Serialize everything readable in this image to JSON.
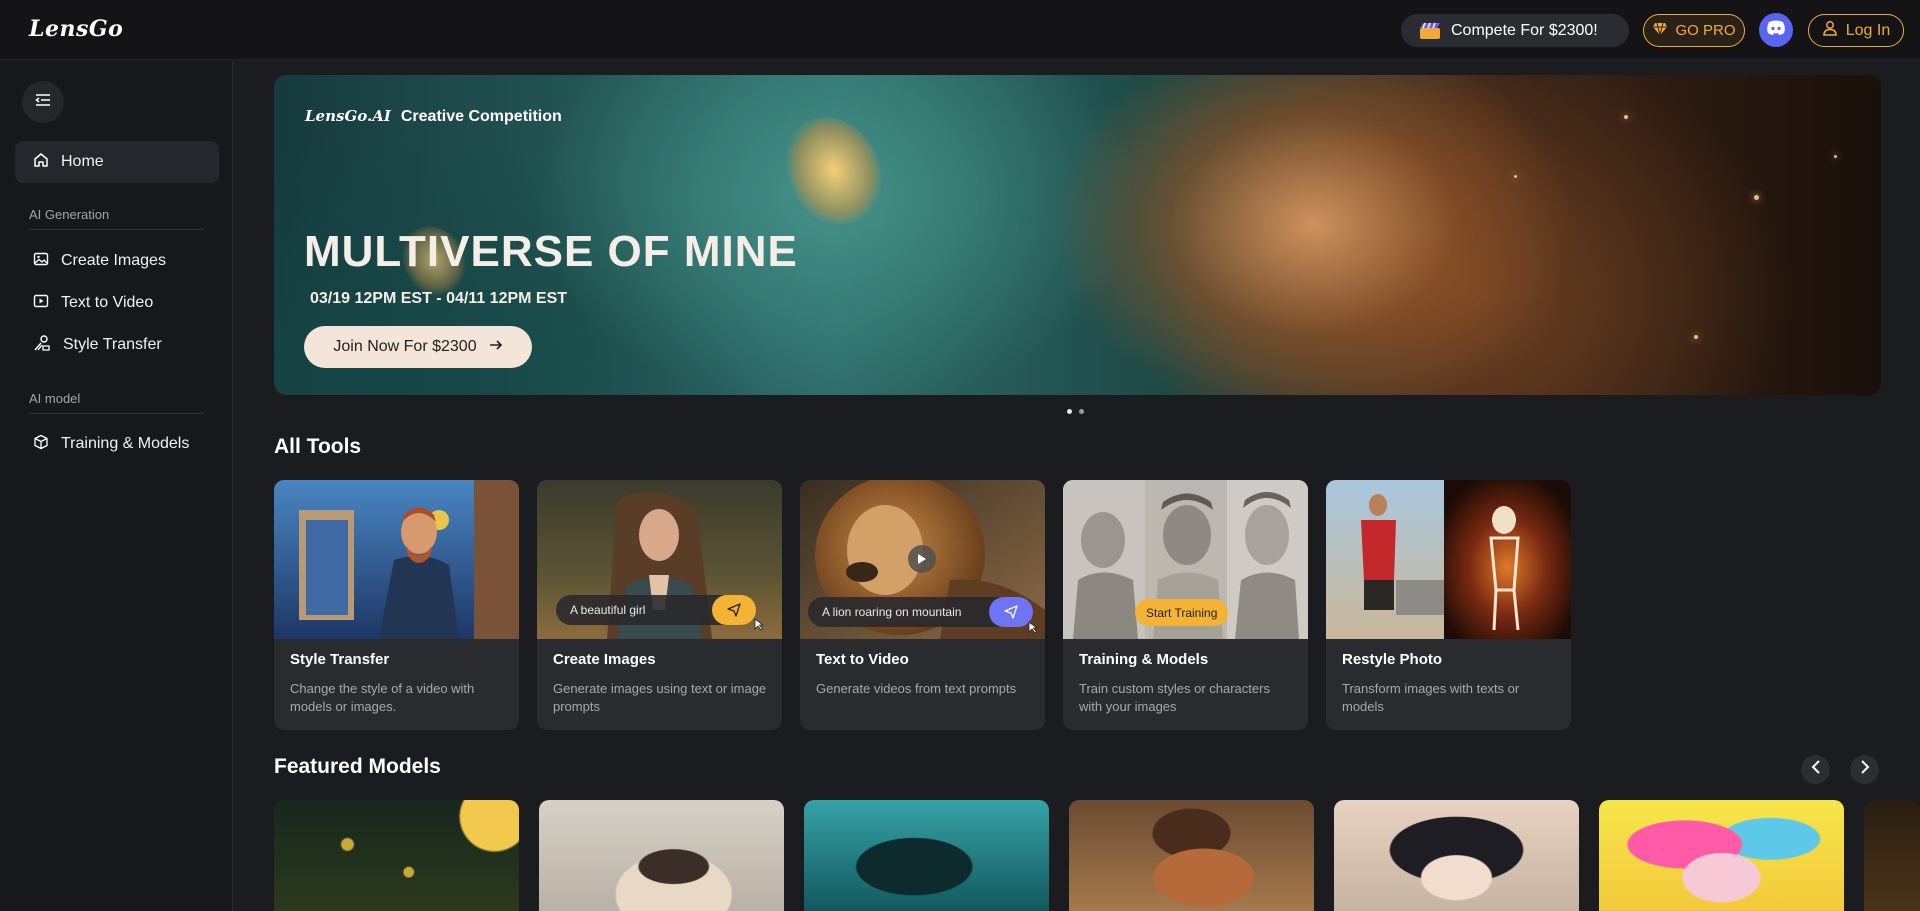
{
  "header": {
    "logo": "LensGo",
    "compete_label": "Compete For $2300!",
    "gopro_label": "GO PRO",
    "login_label": "Log In"
  },
  "sidebar": {
    "home_label": "Home",
    "section_ai_generation": "AI Generation",
    "items": [
      {
        "label": "Create Images",
        "icon": "image-icon"
      },
      {
        "label": "Text to Video",
        "icon": "video-play-icon"
      },
      {
        "label": "Style Transfer",
        "icon": "style-transfer-icon"
      }
    ],
    "section_ai_model": "AI model",
    "model_items": [
      {
        "label": "Training & Models",
        "icon": "cube-icon"
      }
    ]
  },
  "banner": {
    "brand": "LensGo.AI",
    "brand_sub": "Creative Competition",
    "title": "MULTIVERSE OF MINE",
    "dates": "03/19 12PM EST - 04/11 12PM EST",
    "cta": "Join Now For $2300",
    "slides": 2,
    "active_slide": 1
  },
  "tools": {
    "title": "All Tools",
    "cards": [
      {
        "name": "Style Transfer",
        "desc": "Change the style of a video with models or images."
      },
      {
        "name": "Create Images",
        "desc": "Generate images using text or image prompts",
        "prompt": "A beautiful girl"
      },
      {
        "name": "Text to Video",
        "desc": "Generate videos from text prompts",
        "prompt": "A lion roaring on mountain"
      },
      {
        "name": "Training & Models",
        "desc": "Train custom styles or characters with your images",
        "badge": "Start Training"
      },
      {
        "name": "Restyle Photo",
        "desc": "Transform images with texts or models"
      }
    ]
  },
  "featured": {
    "title": "Featured Models"
  },
  "colors": {
    "accent": "#f2a93b",
    "discord": "#5865f2",
    "background": "#1b1c1f",
    "card": "#2a2b2f"
  }
}
